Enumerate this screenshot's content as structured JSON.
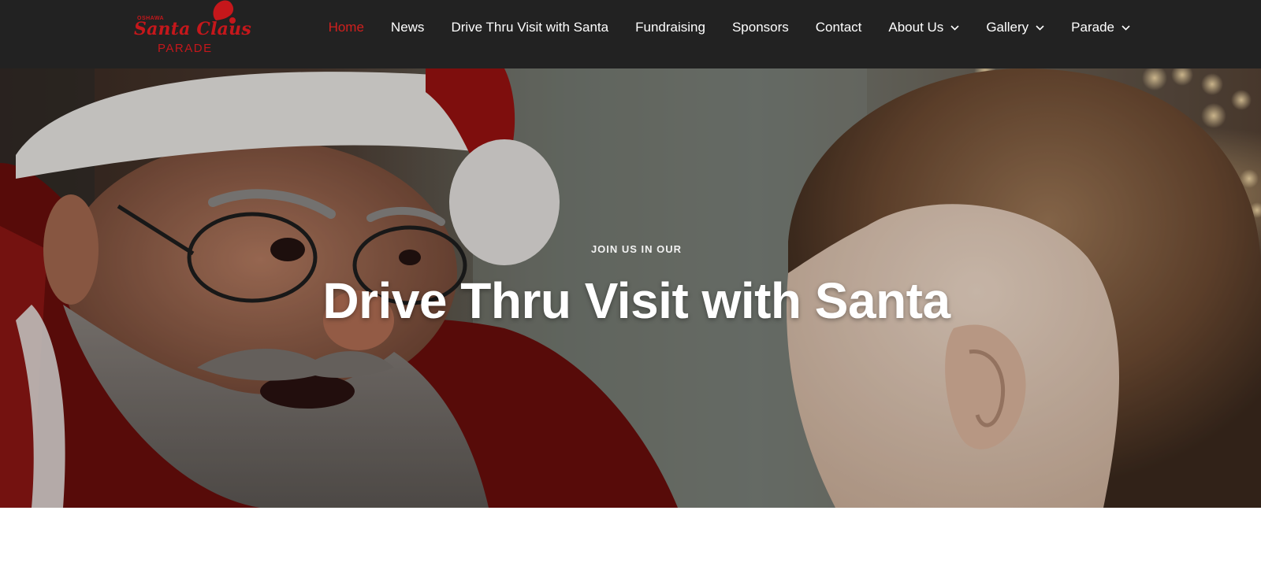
{
  "header": {
    "logo": {
      "small_text": "OSHAWA",
      "main_text": "Santa Claus",
      "sub_text": "PARADE",
      "color": "#c5171b"
    },
    "nav": {
      "items": [
        {
          "label": "Home",
          "active": true,
          "has_dropdown": false
        },
        {
          "label": "News",
          "active": false,
          "has_dropdown": false
        },
        {
          "label": "Drive Thru Visit with Santa",
          "active": false,
          "has_dropdown": false
        },
        {
          "label": "Fundraising",
          "active": false,
          "has_dropdown": false
        },
        {
          "label": "Sponsors",
          "active": false,
          "has_dropdown": false
        },
        {
          "label": "Contact",
          "active": false,
          "has_dropdown": false
        },
        {
          "label": "About Us",
          "active": false,
          "has_dropdown": true,
          "icon": "chevron-down-icon"
        },
        {
          "label": "Gallery",
          "active": false,
          "has_dropdown": true,
          "icon": "chevron-down-icon"
        },
        {
          "label": "Parade",
          "active": false,
          "has_dropdown": true,
          "icon": "chevron-down-icon"
        }
      ],
      "active_color": "#d0201e",
      "text_color": "#ffffff"
    },
    "background": "#222222"
  },
  "hero": {
    "eyebrow": "JOIN US IN OUR",
    "title": "Drive Thru Visit with Santa"
  }
}
